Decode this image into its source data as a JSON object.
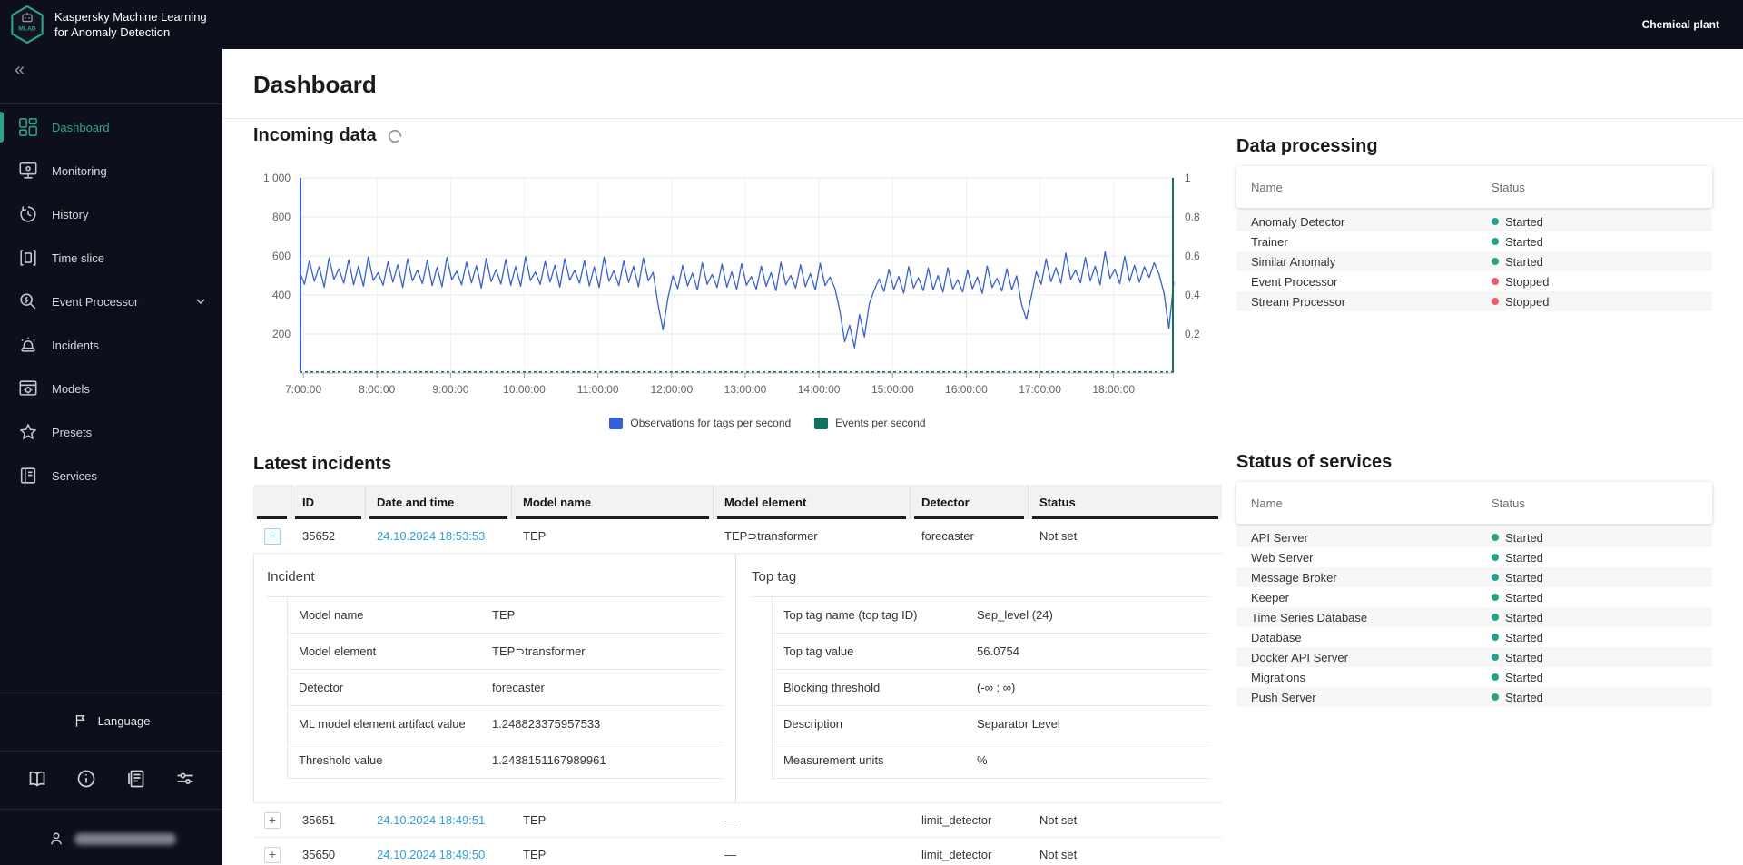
{
  "topbar": {
    "app_title_line1": "Kaspersky Machine Learning",
    "app_title_line2": "for Anomaly Detection",
    "logo_text": "MLAD",
    "context_label": "Chemical plant"
  },
  "sidebar": {
    "collapse_glyph": "«",
    "items": [
      {
        "label": "Dashboard",
        "active": true
      },
      {
        "label": "Monitoring",
        "active": false
      },
      {
        "label": "History",
        "active": false
      },
      {
        "label": "Time slice",
        "active": false
      },
      {
        "label": "Event Processor",
        "active": false,
        "has_submenu": true
      },
      {
        "label": "Incidents",
        "active": false
      },
      {
        "label": "Models",
        "active": false
      },
      {
        "label": "Presets",
        "active": false
      },
      {
        "label": "Services",
        "active": false
      }
    ],
    "language_label": "Language"
  },
  "page": {
    "title": "Dashboard"
  },
  "incoming": {
    "title": "Incoming data"
  },
  "chart_data": {
    "type": "line",
    "title": "Incoming data",
    "x_domain_minutes": [
      0,
      712
    ],
    "t0_label": "6:57",
    "step_min": 4,
    "x_ticks": [
      {
        "label": "7:00:00",
        "min": 3
      },
      {
        "label": "8:00:00",
        "min": 63
      },
      {
        "label": "9:00:00",
        "min": 123
      },
      {
        "label": "10:00:00",
        "min": 183
      },
      {
        "label": "11:00:00",
        "min": 243
      },
      {
        "label": "12:00:00",
        "min": 303
      },
      {
        "label": "13:00:00",
        "min": 363
      },
      {
        "label": "14:00:00",
        "min": 423
      },
      {
        "label": "15:00:00",
        "min": 483
      },
      {
        "label": "16:00:00",
        "min": 543
      },
      {
        "label": "17:00:00",
        "min": 603
      },
      {
        "label": "18:00:00",
        "min": 663
      }
    ],
    "ylim_left": [
      0,
      1000
    ],
    "ylim_right": [
      0,
      1
    ],
    "left_ticks": [
      {
        "label": "1 000",
        "v": 1000
      },
      {
        "label": "800",
        "v": 800
      },
      {
        "label": "600",
        "v": 600
      },
      {
        "label": "400",
        "v": 400
      },
      {
        "label": "200",
        "v": 200
      }
    ],
    "right_ticks": [
      {
        "label": "1",
        "v": 1000
      },
      {
        "label": "0.8",
        "v": 800
      },
      {
        "label": "0.6",
        "v": 600
      },
      {
        "label": "0.4",
        "v": 400
      },
      {
        "label": "0.2",
        "v": 200
      }
    ],
    "series": [
      {
        "name": "Observations for tags per second",
        "color": "#3560d8",
        "values": [
          520,
          455,
          575,
          470,
          545,
          440,
          590,
          480,
          535,
          460,
          580,
          452,
          548,
          445,
          595,
          475,
          515,
          450,
          570,
          465,
          555,
          438,
          585,
          472,
          528,
          458,
          578,
          448,
          542,
          442,
          592,
          478,
          522,
          452,
          568,
          462,
          550,
          436,
          588,
          468,
          530,
          456,
          582,
          450,
          546,
          444,
          596,
          474,
          518,
          454,
          572,
          466,
          552,
          440,
          586,
          476,
          526,
          460,
          576,
          446,
          544,
          438,
          594,
          470,
          524,
          448,
          574,
          464,
          548,
          442,
          590,
          472,
          516,
          350,
          222,
          385,
          498,
          432,
          552,
          446,
          512,
          425,
          565,
          455,
          505,
          438,
          558,
          440,
          518,
          428,
          560,
          450,
          495,
          430,
          548,
          444,
          515,
          422,
          568,
          452,
          500,
          435,
          555,
          442,
          510,
          426,
          562,
          448,
          492,
          434,
          320,
          160,
          245,
          130,
          300,
          185,
          355,
          425,
          482,
          418,
          532,
          428,
          495,
          410,
          545,
          435,
          488,
          422,
          538,
          425,
          500,
          415,
          540,
          430,
          478,
          416,
          528,
          432,
          492,
          408,
          548,
          438,
          485,
          420,
          535,
          426,
          498,
          352,
          275,
          395,
          520,
          455,
          585,
          468,
          540,
          460,
          615,
          480,
          528,
          462,
          592,
          472,
          548,
          452,
          622,
          485,
          532,
          458,
          598,
          470,
          552,
          465,
          545,
          490,
          565,
          505,
          410,
          228,
          468
        ]
      },
      {
        "name": "Events per second",
        "color": "#11735f",
        "constant": 0.002
      }
    ]
  },
  "data_processing": {
    "title": "Data processing",
    "columns": [
      "Name",
      "Status"
    ],
    "rows": [
      {
        "name": "Anomaly Detector",
        "status": "Started",
        "state": "started"
      },
      {
        "name": "Trainer",
        "status": "Started",
        "state": "started"
      },
      {
        "name": "Similar Anomaly",
        "status": "Started",
        "state": "started"
      },
      {
        "name": "Event Processor",
        "status": "Stopped",
        "state": "stopped"
      },
      {
        "name": "Stream Processor",
        "status": "Stopped",
        "state": "stopped"
      }
    ]
  },
  "status_of_services": {
    "title": "Status of services",
    "columns": [
      "Name",
      "Status"
    ],
    "rows": [
      {
        "name": "API Server",
        "status": "Started",
        "state": "started"
      },
      {
        "name": "Web Server",
        "status": "Started",
        "state": "started"
      },
      {
        "name": "Message Broker",
        "status": "Started",
        "state": "started"
      },
      {
        "name": "Keeper",
        "status": "Started",
        "state": "started"
      },
      {
        "name": "Time Series Database",
        "status": "Started",
        "state": "started"
      },
      {
        "name": "Database",
        "status": "Started",
        "state": "started"
      },
      {
        "name": "Docker API Server",
        "status": "Started",
        "state": "started"
      },
      {
        "name": "Migrations",
        "status": "Started",
        "state": "started"
      },
      {
        "name": "Push Server",
        "status": "Started",
        "state": "started"
      }
    ]
  },
  "incidents": {
    "title": "Latest incidents",
    "columns": [
      "ID",
      "Date and time",
      "Model name",
      "Model element",
      "Detector",
      "Status"
    ],
    "rows": [
      {
        "expand_glyph": "−",
        "id": "35652",
        "date": "24.10.2024 18:53:53",
        "model": "TEP",
        "element": "TEP⊃transformer",
        "detector": "forecaster",
        "status": "Not set",
        "expanded": true
      },
      {
        "expand_glyph": "+",
        "id": "35651",
        "date": "24.10.2024 18:49:51",
        "model": "TEP",
        "element": "—",
        "detector": "limit_detector",
        "status": "Not set",
        "expanded": false
      },
      {
        "expand_glyph": "+",
        "id": "35650",
        "date": "24.10.2024 18:49:50",
        "model": "TEP",
        "element": "—",
        "detector": "limit_detector",
        "status": "Not set",
        "expanded": false
      }
    ],
    "detail": {
      "incident": {
        "title": "Incident",
        "rows": [
          [
            "Model name",
            "TEP"
          ],
          [
            "Model element",
            "TEP⊃transformer"
          ],
          [
            "Detector",
            "forecaster"
          ],
          [
            "ML model element artifact value",
            "1.248823375957533"
          ],
          [
            "Threshold value",
            "1.2438151167989961"
          ]
        ]
      },
      "top_tag": {
        "title": "Top tag",
        "rows": [
          [
            "Top tag name (top tag ID)",
            "Sep_level (24)"
          ],
          [
            "Top tag value",
            "56.0754"
          ],
          [
            "Blocking threshold",
            "(-∞ : ∞)"
          ],
          [
            "Description",
            "Separator Level"
          ],
          [
            "Measurement units",
            "%"
          ]
        ]
      }
    }
  },
  "colors": {
    "started": "#1fa58c",
    "stopped": "#f4586b",
    "accent": "#27a48c",
    "link": "#2b9fe8",
    "observations_line": "#3560d8",
    "events_line": "#11735f"
  }
}
